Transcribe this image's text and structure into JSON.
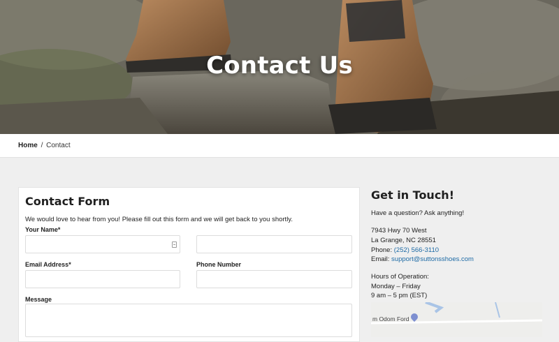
{
  "hero": {
    "title": "Contact Us"
  },
  "breadcrumb": {
    "home": "Home",
    "separator": "/",
    "current": "Contact"
  },
  "form": {
    "title": "Contact Form",
    "intro": "We would love to hear from you! Please fill out this form and we will get back to you shortly.",
    "name_label": "Your Name*",
    "email_label": "Email Address*",
    "phone_label": "Phone Number",
    "message_label": "Message",
    "first_name_value": "",
    "last_name_value": "",
    "email_value": "",
    "phone_value": "",
    "message_value": ""
  },
  "contact": {
    "title": "Get in Touch!",
    "question": "Have a question? Ask anything!",
    "address_line1": "7943 Hwy 70 West",
    "address_line2": "La Grange, NC 28551",
    "phone_label": "Phone:",
    "phone": "(252) 566-3110",
    "email_label": "Email:",
    "email": "support@suttonsshoes.com",
    "hours_title": "Hours of Operation:",
    "hours_days": "Monday – Friday",
    "hours_time": "9 am – 5 pm (EST)"
  },
  "map": {
    "label": "m Odom Ford"
  },
  "colors": {
    "link": "#1d6aa5",
    "page_bg": "#efefef",
    "card_bg": "#ffffff"
  }
}
